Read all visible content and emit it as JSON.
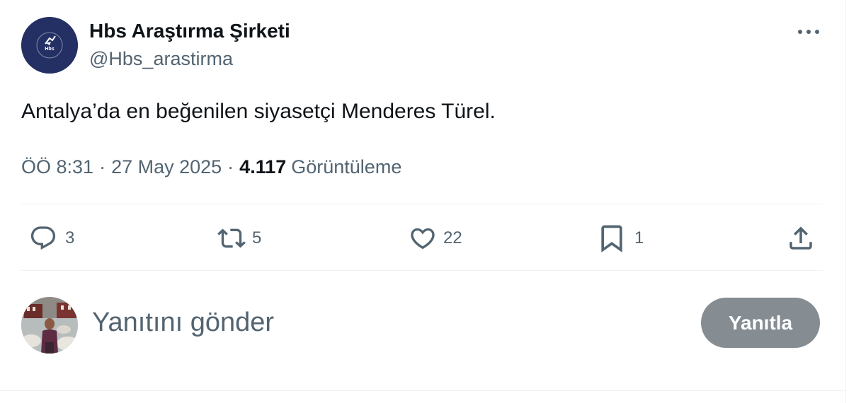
{
  "tweet": {
    "author": {
      "display_name": "Hbs Araştırma Şirketi",
      "handle": "@Hbs_arastirma",
      "avatar_logo_text": "Hbs"
    },
    "text": "Antalya’da en beğenilen siyasetçi Menderes Türel.",
    "meta": {
      "time": "ÖÖ 8:31",
      "separator": "·",
      "date": "27 May 2025",
      "views_count": "4.117",
      "views_label": "Görüntüleme"
    },
    "actions": {
      "replies": {
        "icon": "reply-icon",
        "count": "3"
      },
      "retweets": {
        "icon": "retweet-icon",
        "count": "5"
      },
      "likes": {
        "icon": "heart-icon",
        "count": "22"
      },
      "bookmarks": {
        "icon": "bookmark-icon",
        "count": "1"
      },
      "share": {
        "icon": "share-icon"
      }
    }
  },
  "reply_composer": {
    "placeholder": "Yanıtını gönder",
    "button_label": "Yanıtla"
  },
  "colors": {
    "text_primary": "#0f1419",
    "text_secondary": "#536471",
    "divider": "#eff3f4",
    "reply_button_disabled": "#858c92",
    "brand_avatar_bg": "#243064"
  }
}
